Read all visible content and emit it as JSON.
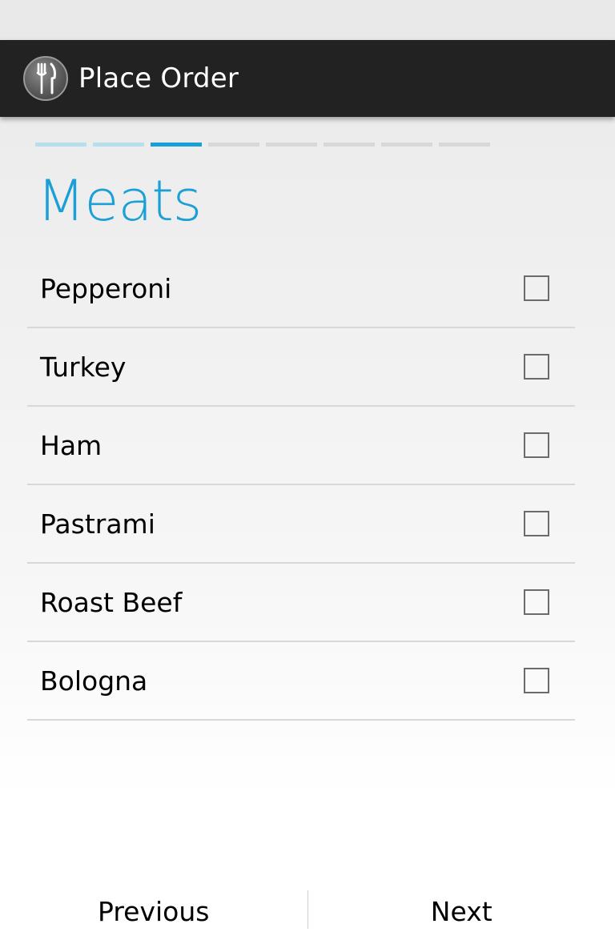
{
  "action_bar": {
    "title": "Place Order",
    "icon": "fork-knife-icon"
  },
  "wizard": {
    "total_steps": 8,
    "current_step": 3,
    "page_title": "Meats"
  },
  "options": [
    {
      "label": "Pepperoni",
      "checked": false
    },
    {
      "label": "Turkey",
      "checked": false
    },
    {
      "label": "Ham",
      "checked": false
    },
    {
      "label": "Pastrami",
      "checked": false
    },
    {
      "label": "Roast Beef",
      "checked": false
    },
    {
      "label": "Bologna",
      "checked": false
    }
  ],
  "footer": {
    "previous_label": "Previous",
    "next_label": "Next"
  },
  "colors": {
    "accent": "#1aa0d6",
    "action_bar": "#222222",
    "step_done": "#b5dfec",
    "step_pending": "#d8d8d8"
  }
}
